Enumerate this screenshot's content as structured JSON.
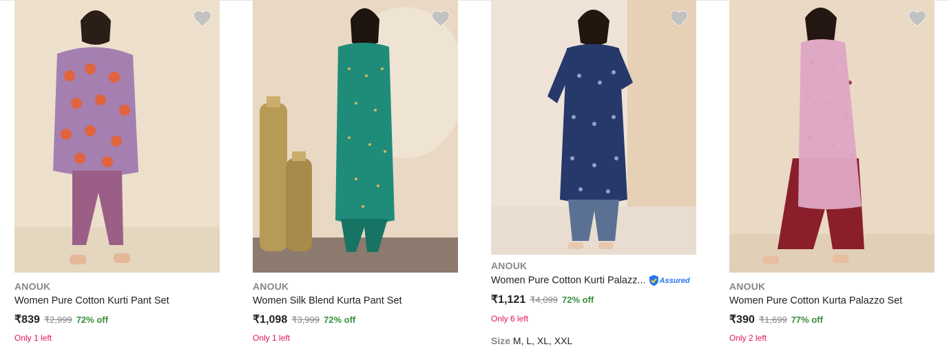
{
  "colors": {
    "discount": "#388e3c",
    "stock": "#e0115f",
    "brand": "#878787",
    "assured": "#2874f0"
  },
  "products": [
    {
      "image_alt": "woman in purple printed kurti and pant set",
      "brand": "ANOUK",
      "title": "Women Pure Cotton Kurti Pant Set",
      "price": "₹839",
      "mrp": "₹2,999",
      "discount": "72% off",
      "stock": "Only 1 left",
      "wishlist_icon": "heart-icon"
    },
    {
      "image_alt": "woman in teal silk blend kurta pant set",
      "brand": "ANOUK",
      "title": "Women Silk Blend Kurta Pant Set",
      "price": "₹1,098",
      "mrp": "₹3,999",
      "discount": "72% off",
      "stock": "Only 1 left",
      "wishlist_icon": "heart-icon"
    },
    {
      "image_alt": "woman in navy printed kurti palazzo set",
      "brand": "ANOUK",
      "title": "Women Pure Cotton Kurti Palazz...",
      "assured_label": "Assured",
      "price": "₹1,121",
      "mrp": "₹4,099",
      "discount": "72% off",
      "stock": "Only 6 left",
      "size_label": "Size",
      "sizes": "M, L, XL, XXL",
      "wishlist_icon": "heart-icon"
    },
    {
      "image_alt": "woman in pink printed kurta and maroon palazzo",
      "brand": "ANOUK",
      "title": "Women Pure Cotton Kurta Palazzo Set",
      "price": "₹390",
      "mrp": "₹1,699",
      "discount": "77% off",
      "stock": "Only 2 left",
      "wishlist_icon": "heart-icon"
    }
  ]
}
